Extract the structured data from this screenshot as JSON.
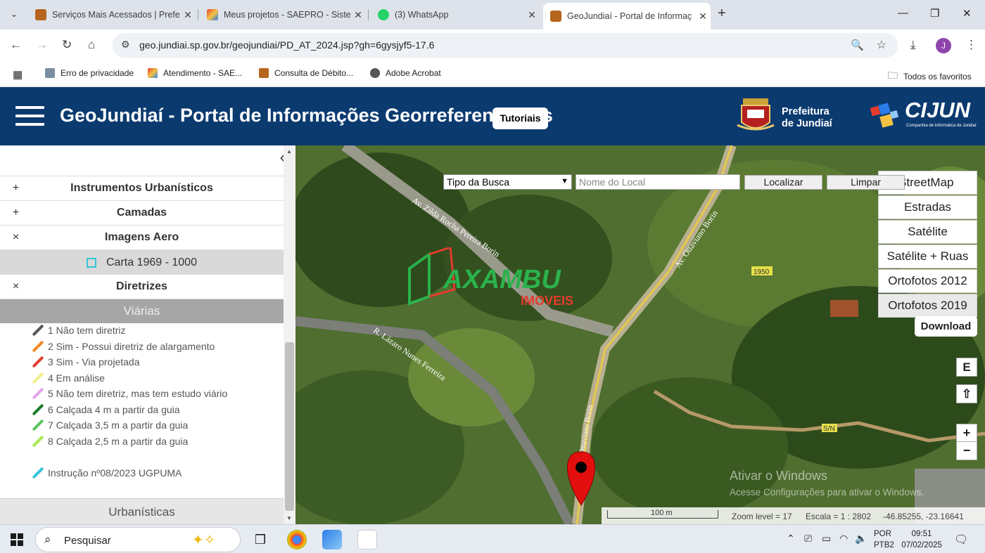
{
  "browser": {
    "tabs": [
      {
        "title": "Serviços Mais Acessados | Prefe",
        "active": false
      },
      {
        "title": "Meus projetos - SAEPRO - Siste",
        "active": false
      },
      {
        "title": "(3) WhatsApp",
        "active": false
      },
      {
        "title": "GeoJundiaí - Portal de Informaç",
        "active": true
      }
    ],
    "url": "geo.jundiai.sp.gov.br/geojundiai/PD_AT_2024.jsp?gh=6gysjyf5-17.6",
    "profile_initial": "J",
    "bookmarks": [
      "Erro de privacidade",
      "Atendimento - SAE...",
      "Consulta de Débito...",
      "Adobe Acrobat"
    ],
    "all_bookmarks": "Todos os favoritos"
  },
  "header": {
    "title": "GeoJundiaí - Portal de Informações Georreferenciadas",
    "tutorials": "Tutoriais",
    "pref_line1": "Prefeitura",
    "pref_line2": "de Jundiaí",
    "cijun": "CIJUN",
    "cijun_sub": "Companhia de Informática de Jundiaí"
  },
  "sidebar": {
    "sections": [
      {
        "sign": "+",
        "label": "Instrumentos Urbanísticos"
      },
      {
        "sign": "+",
        "label": "Camadas"
      },
      {
        "sign": "×",
        "label": "Imagens Aero"
      },
      {
        "sign": "×",
        "label": "Diretrizes"
      }
    ],
    "carta": "Carta 1969 - 1000",
    "viarias": "Viárias",
    "legend": [
      {
        "label": "1 Não tem diretriz",
        "color": "#555555"
      },
      {
        "label": "2 Sim - Possui diretriz de alargamento",
        "color": "#f08a24"
      },
      {
        "label": "3 Sim -  Via projetada",
        "color": "#e53b2c"
      },
      {
        "label": "4 Em análise",
        "color": "#f4ef8a"
      },
      {
        "label": "5 Não tem diretriz, mas tem estudo viário",
        "color": "#e3a6ec"
      },
      {
        "label": "6 Calçada 4 m a partir da guia",
        "color": "#1d7a2a"
      },
      {
        "label": "7 Calçada 3,5 m a partir da guia",
        "color": "#5cc45a"
      },
      {
        "label": "8 Calçada 2,5 m a partir da guia",
        "color": "#a8e84f"
      },
      {
        "label": "Instrução nº08/2023 UGPUMA",
        "color": "#33c5d6"
      }
    ],
    "urbanisticas": "Urbanísticas"
  },
  "map": {
    "search_type": "Tipo da Busca",
    "search_placeholder": "Nome do Local",
    "localizar": "Localizar",
    "limpar": "Limpar",
    "layers": [
      "OpenStreetMap",
      "Estradas",
      "Satélite",
      "Satélite + Ruas",
      "Ortofotos 2012",
      "Ortofotos 2019"
    ],
    "download": "Download",
    "ctrl_e": "E",
    "ctrl_up": "⇧",
    "zoom_in": "+",
    "zoom_out": "−",
    "street_labels": [
      "Av. Zilda Rocha Pereira Borin",
      "Av. Ottaviano Borin",
      "R. Lázaro Nunes Ferreira",
      "Ottaviano Borin",
      "1950",
      "S/N"
    ],
    "watermark": "AXAMBU",
    "watermark_sub": "IMOVEIS",
    "activate_title": "Ativar o Windows",
    "activate_sub": "Acesse Configurações para ativar o Windows.",
    "scale_label": "100 m",
    "zoom_level": "Zoom level = 17",
    "escala": "Escala = 1 : 2802",
    "coords": "-46.85255, -23.16641"
  },
  "taskbar": {
    "search": "Pesquisar",
    "lang1": "POR",
    "lang2": "PTB2",
    "time": "09:51",
    "date": "07/02/2025"
  }
}
